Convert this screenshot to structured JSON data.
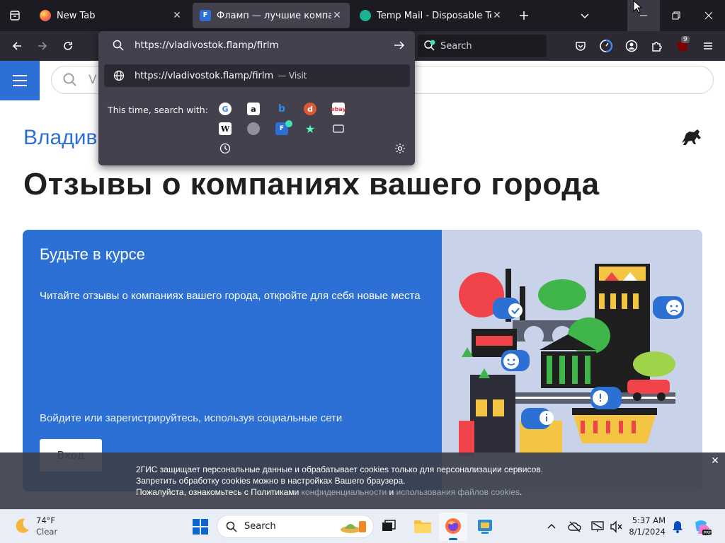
{
  "browser": {
    "tabs": [
      {
        "title": "New Tab",
        "active": false
      },
      {
        "title": "Фламп — лучшие компании В",
        "active": true
      },
      {
        "title": "Temp Mail - Disposable Tempo",
        "active": false
      }
    ],
    "address": "https://vladivostok.flamp/firlm",
    "search_placeholder": "Search",
    "extension_badge": "9"
  },
  "url_dropdown": {
    "result_url": "https://vladivostok.flamp/firlm",
    "result_action": "— Visit",
    "search_with_label": "This time, search with:",
    "engines": [
      "google-icon",
      "amazon-icon",
      "bing-icon",
      "duckduckgo-icon",
      "ebay-icon",
      "wikipedia-icon",
      "search-engine-icon",
      "flamp-icon",
      "bookmarks-icon",
      "tabs-icon",
      "history-icon"
    ]
  },
  "page": {
    "search_placeholder_partial": "V",
    "city": "Владив",
    "heading": "Отзывы о компаниях вашего города",
    "promo": {
      "title": "Будьте в курсе",
      "description": "Читайте отзывы о компаниях вашего города, откройте для себя новые места",
      "login_text": "Войдите или зарегистрируйтесь, используя социальные сети",
      "enter_button": "Вход"
    }
  },
  "cookie_banner": {
    "line1": "2ГИС защищает персональные данные и обрабатывает cookies только для персонализации сервисов.",
    "line2": "Запретить обработку cookies можно в настройках Вашего браузера.",
    "line3_prefix": "Пожалуйста, ознакомьтесь с Политиками ",
    "link1": "конфиденциальности",
    "and": " и ",
    "link2": "использования файлов cookies",
    "end": "."
  },
  "taskbar": {
    "temperature": "74°F",
    "condition": "Clear",
    "search_label": "Search",
    "time": "5:37 AM",
    "date": "8/1/2024"
  },
  "colors": {
    "accent": "#2c70d6",
    "browser_bg": "#1c1b22",
    "panel": "#42414d"
  }
}
